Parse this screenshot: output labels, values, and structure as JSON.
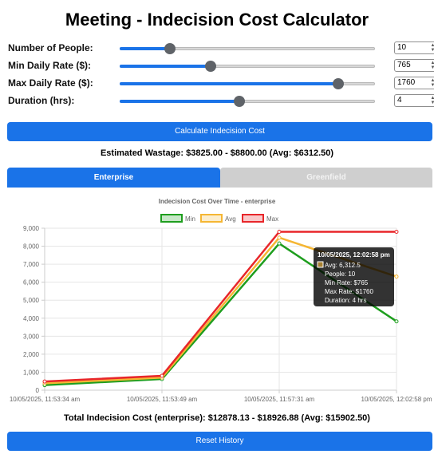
{
  "header": {
    "title": "Meeting - Indecision Cost Calculator"
  },
  "inputs": [
    {
      "label": "Number of People:",
      "value": "10",
      "min": 1,
      "max": 50,
      "current": 10
    },
    {
      "label": "Min Daily Rate ($):",
      "value": "765",
      "min": 100,
      "max": 2000,
      "current": 765
    },
    {
      "label": "Max Daily Rate ($):",
      "value": "1760",
      "min": 100,
      "max": 2000,
      "current": 1760
    },
    {
      "label": "Duration (hrs):",
      "value": "4",
      "min": 0.5,
      "max": 8,
      "current": 4
    }
  ],
  "calculate_button": {
    "label": "Calculate Indecision Cost"
  },
  "wastage_text": "Estimated Wastage: $3825.00 - $8800.00 (Avg: $6312.50)",
  "tabs": [
    {
      "label": "Enterprise",
      "active": true
    },
    {
      "label": "Greenfield",
      "active": false
    }
  ],
  "chart_data": {
    "type": "line",
    "title": "Indecision Cost Over Time - enterprise",
    "categories": [
      "10/05/2025, 11:53:34 am",
      "10/05/2025, 11:53:49 am",
      "10/05/2025, 11:57:31 am",
      "10/05/2025, 12:02:58 pm"
    ],
    "series": [
      {
        "name": "Min",
        "color": "#1e9e1e",
        "values": [
          280,
          620,
          8150,
          3825
        ]
      },
      {
        "name": "Avg",
        "color": "#f5b633",
        "values": [
          380,
          700,
          8475,
          6312.5
        ]
      },
      {
        "name": "Max",
        "color": "#e8262a",
        "values": [
          480,
          800,
          8800,
          8800
        ]
      }
    ],
    "ylim": [
      0,
      9000
    ],
    "yticks": [
      "0",
      "1,000",
      "2,000",
      "3,000",
      "4,000",
      "5,000",
      "6,000",
      "7,000",
      "8,000",
      "9,000"
    ],
    "legend_position": "top",
    "grid": true,
    "tooltip": {
      "title": "10/05/2025, 12:02:58 pm",
      "lines": [
        "Avg: 6,312.5",
        "People: 10",
        "Min Rate: $765",
        "Max Rate: $1760",
        "Duration: 4 hrs"
      ]
    }
  },
  "total_text": "Total Indecision Cost (enterprise): $12878.13 - $18926.88 (Avg: $15902.50)",
  "reset_button": {
    "label": "Reset History"
  }
}
